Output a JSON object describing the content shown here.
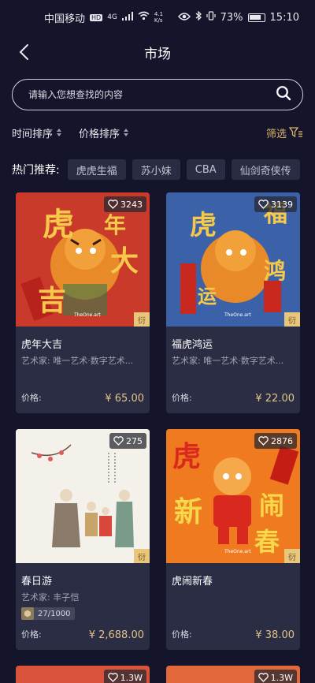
{
  "status_bar": {
    "carrier": "中国移动",
    "network": "HD",
    "signal": "4G",
    "speed_value": "4.1",
    "speed_unit": "K/s",
    "battery": "73%",
    "time": "15:10"
  },
  "header": {
    "title": "市场"
  },
  "search": {
    "placeholder": "请输入您想查找的内容"
  },
  "sort": {
    "time_label": "时间排序",
    "price_label": "价格排序",
    "filter_label": "筛选"
  },
  "hot": {
    "label": "热门推荐:",
    "tags": [
      "虎虎生福",
      "苏小妹",
      "CBA",
      "仙剑奇侠传"
    ]
  },
  "cards": [
    {
      "name": "虎年大吉",
      "artist": "艺术家: 唯一艺术·数字艺术...",
      "likes": "3243",
      "price_label": "价格:",
      "price": "¥ 65.00",
      "corner": "衍",
      "art_chars": [
        "虎",
        "年",
        "大",
        "吉"
      ],
      "art_bg": "#c93a2a",
      "watermark": "TheOne.art"
    },
    {
      "name": "福虎鸿运",
      "artist": "艺术家: 唯一艺术·数字艺术...",
      "likes": "3139",
      "price_label": "价格:",
      "price": "¥ 22.00",
      "corner": "衍",
      "art_chars": [
        "虎",
        "福",
        "鸿",
        "运"
      ],
      "art_bg": "#3b62a8",
      "watermark": "TheOne.art"
    },
    {
      "name": "春日游",
      "artist": "艺术家: 丰子恺",
      "likes": "275",
      "edition": "27/1000",
      "price_label": "价格:",
      "price": "¥ 2,688.00",
      "corner": "衍",
      "art_bg": "#f4f1ea"
    },
    {
      "name": "虎闹新春",
      "artist": "",
      "likes": "2876",
      "price_label": "价格:",
      "price": "¥ 38.00",
      "corner": "衍",
      "art_chars": [
        "虎",
        "新",
        "闹",
        "春"
      ],
      "art_bg": "#f07a1f",
      "watermark": "TheOne.art"
    },
    {
      "likes": "1.3W",
      "art_bg": "#d9533a"
    },
    {
      "likes": "1.3W",
      "art_bg": "#e0683a"
    }
  ],
  "icons": {
    "back": "chevron-left-icon",
    "search": "search-icon",
    "filter": "filter-icon",
    "like": "heart-icon"
  },
  "colors": {
    "background": "#14152a",
    "card": "#2b2d44",
    "accent_gold": "#e2c487"
  }
}
